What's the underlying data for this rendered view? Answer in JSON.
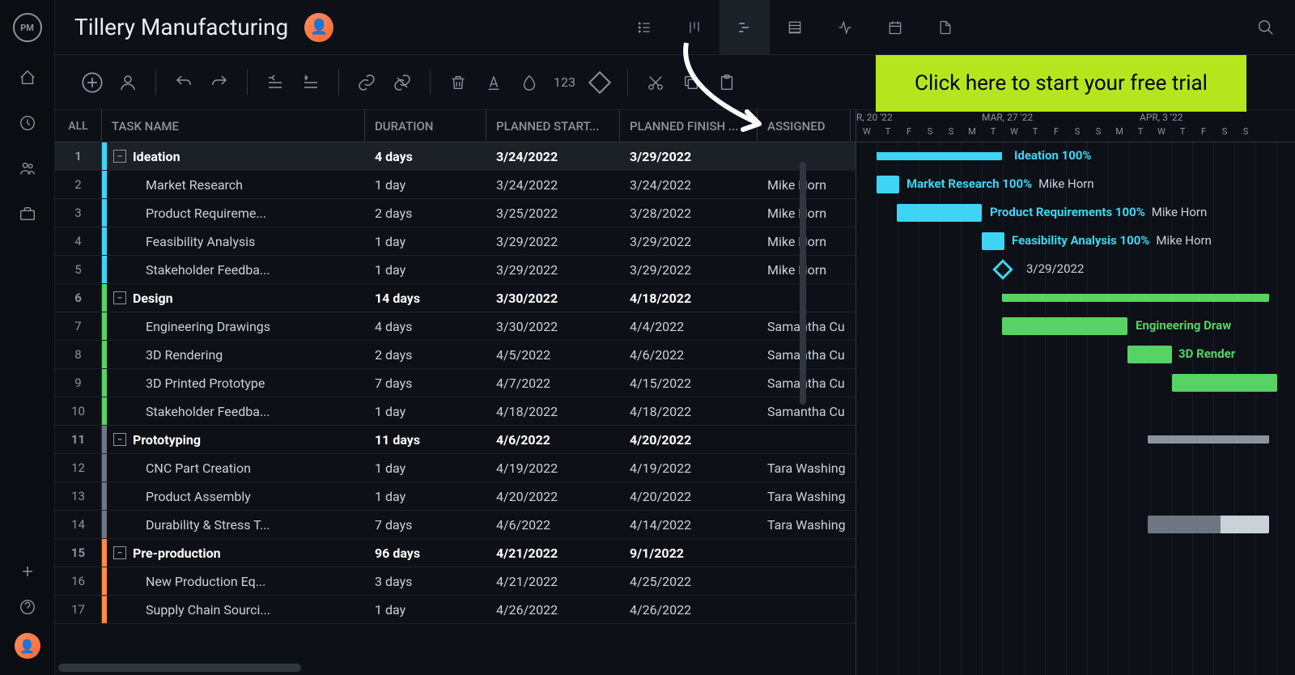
{
  "project_title": "Tillery Manufacturing",
  "cta_text": "Click here to start your free trial",
  "columns": {
    "all": "ALL",
    "name": "TASK NAME",
    "duration": "DURATION",
    "planned_start": "PLANNED START...",
    "planned_finish": "PLANNED FINISH ...",
    "assigned": "ASSIGNED"
  },
  "timeline": {
    "weeks": [
      "R, 20 '22",
      "MAR, 27 '22",
      "APR, 3 '22"
    ],
    "days": [
      "W",
      "T",
      "F",
      "S",
      "S",
      "M",
      "T",
      "W",
      "T",
      "F",
      "S",
      "S",
      "M",
      "T",
      "W",
      "T",
      "F",
      "S",
      "S"
    ]
  },
  "rows": [
    {
      "num": "1",
      "name": "Ideation",
      "dur": "4 days",
      "start": "3/24/2022",
      "end": "3/29/2022",
      "assign": "",
      "type": "parent",
      "color": "cyan",
      "selected": true
    },
    {
      "num": "2",
      "name": "Market Research",
      "dur": "1 day",
      "start": "3/24/2022",
      "end": "3/24/2022",
      "assign": "Mike Horn",
      "type": "child",
      "color": "cyan"
    },
    {
      "num": "3",
      "name": "Product Requireme...",
      "dur": "2 days",
      "start": "3/25/2022",
      "end": "3/28/2022",
      "assign": "Mike Horn",
      "type": "child",
      "color": "cyan"
    },
    {
      "num": "4",
      "name": "Feasibility Analysis",
      "dur": "1 day",
      "start": "3/29/2022",
      "end": "3/29/2022",
      "assign": "Mike Horn",
      "type": "child",
      "color": "cyan"
    },
    {
      "num": "5",
      "name": "Stakeholder Feedba...",
      "dur": "1 day",
      "start": "3/29/2022",
      "end": "3/29/2022",
      "assign": "Mike Horn",
      "type": "child",
      "color": "cyan"
    },
    {
      "num": "6",
      "name": "Design",
      "dur": "14 days",
      "start": "3/30/2022",
      "end": "4/18/2022",
      "assign": "",
      "type": "parent",
      "color": "green"
    },
    {
      "num": "7",
      "name": "Engineering Drawings",
      "dur": "4 days",
      "start": "3/30/2022",
      "end": "4/4/2022",
      "assign": "Samantha Cu",
      "type": "child",
      "color": "green"
    },
    {
      "num": "8",
      "name": "3D Rendering",
      "dur": "2 days",
      "start": "4/5/2022",
      "end": "4/6/2022",
      "assign": "Samantha Cu",
      "type": "child",
      "color": "green"
    },
    {
      "num": "9",
      "name": "3D Printed Prototype",
      "dur": "7 days",
      "start": "4/7/2022",
      "end": "4/15/2022",
      "assign": "Samantha Cu",
      "type": "child",
      "color": "green"
    },
    {
      "num": "10",
      "name": "Stakeholder Feedba...",
      "dur": "1 day",
      "start": "4/18/2022",
      "end": "4/18/2022",
      "assign": "Samantha Cu",
      "type": "child",
      "color": "green"
    },
    {
      "num": "11",
      "name": "Prototyping",
      "dur": "11 days",
      "start": "4/6/2022",
      "end": "4/20/2022",
      "assign": "",
      "type": "parent",
      "color": "gray"
    },
    {
      "num": "12",
      "name": "CNC Part Creation",
      "dur": "1 day",
      "start": "4/19/2022",
      "end": "4/19/2022",
      "assign": "Tara Washing",
      "type": "child",
      "color": "gray"
    },
    {
      "num": "13",
      "name": "Product Assembly",
      "dur": "1 day",
      "start": "4/20/2022",
      "end": "4/20/2022",
      "assign": "Tara Washing",
      "type": "child",
      "color": "gray"
    },
    {
      "num": "14",
      "name": "Durability & Stress T...",
      "dur": "7 days",
      "start": "4/6/2022",
      "end": "4/14/2022",
      "assign": "Tara Washing",
      "type": "child",
      "color": "gray"
    },
    {
      "num": "15",
      "name": "Pre-production",
      "dur": "96 days",
      "start": "4/21/2022",
      "end": "9/1/2022",
      "assign": "",
      "type": "parent",
      "color": "orange"
    },
    {
      "num": "16",
      "name": "New Production Eq...",
      "dur": "3 days",
      "start": "4/21/2022",
      "end": "4/25/2022",
      "assign": "",
      "type": "child",
      "color": "orange"
    },
    {
      "num": "17",
      "name": "Supply Chain Sourci...",
      "dur": "1 day",
      "start": "4/26/2022",
      "end": "4/26/2022",
      "assign": "",
      "type": "child",
      "color": "orange"
    }
  ],
  "gantt_labels": {
    "ideation": "Ideation  100%",
    "market_research": "Market Research  100%",
    "market_research_assignee": "Mike Horn",
    "product_req": "Product Requirements  100%",
    "product_req_assignee": "Mike Horn",
    "feasibility": "Feasibility Analysis  100%",
    "feasibility_assignee": "Mike Horn",
    "milestone_date": "3/29/2022",
    "eng_draw": "Engineering Draw",
    "render3d": "3D Render"
  },
  "tool_number": "123"
}
